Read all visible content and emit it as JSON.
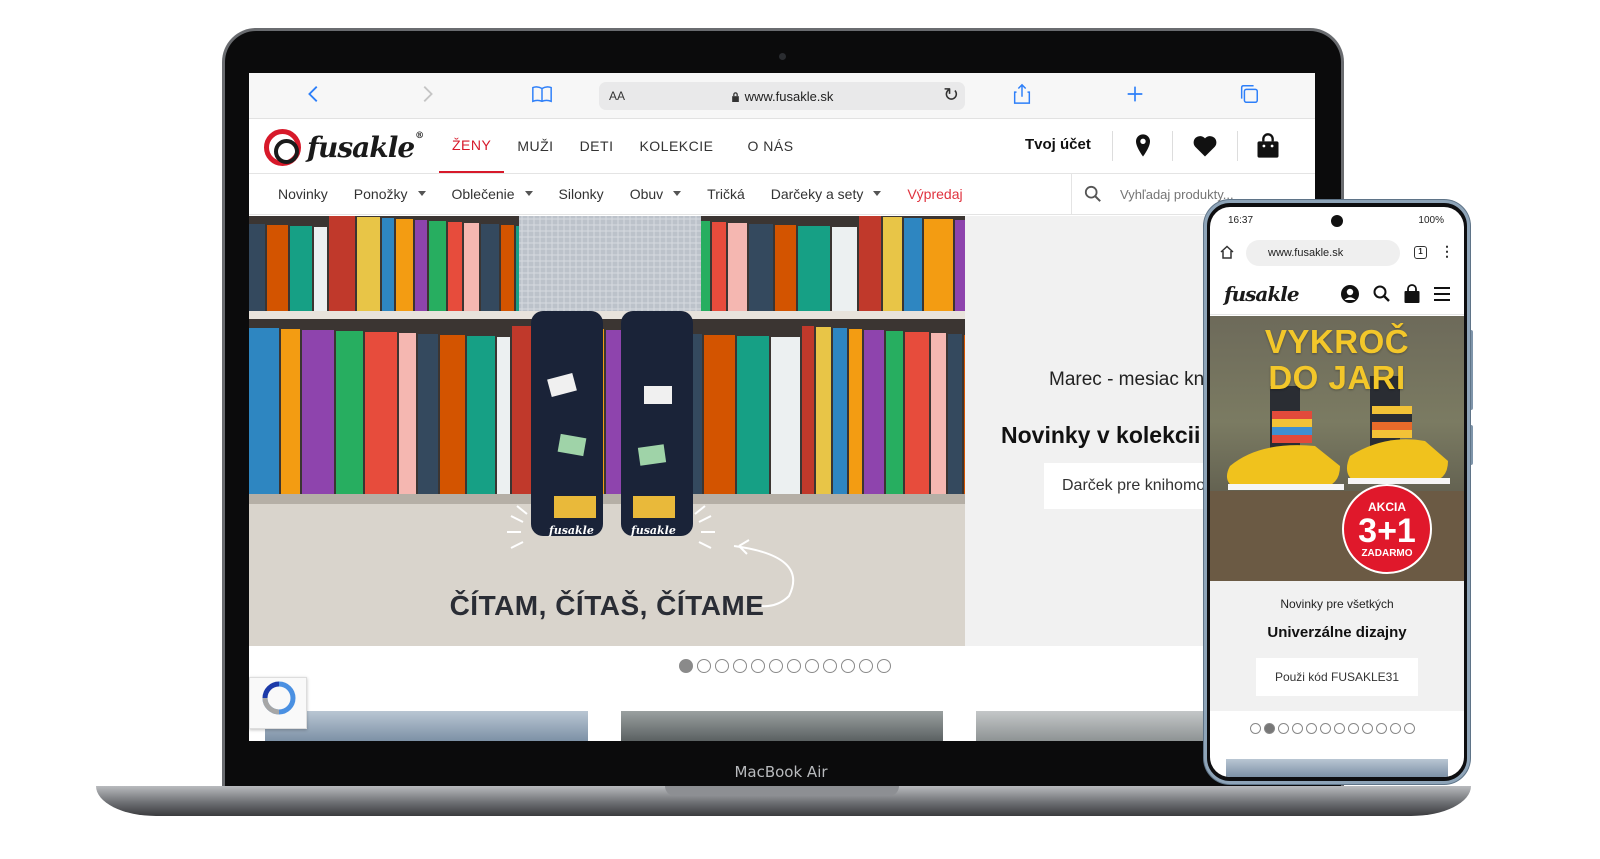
{
  "device": {
    "laptop_label": "MacBook Air"
  },
  "safari": {
    "aa_label": "AA",
    "url": "www.fusakle.sk"
  },
  "site": {
    "logo_text": "fusakle",
    "logo_reg": "®",
    "main_nav": [
      "ŽENY",
      "MUŽI",
      "DETI",
      "KOLEKCIE",
      "O NÁS"
    ],
    "account_label": "Tvoj účet",
    "categories": [
      {
        "label": "Novinky",
        "dropdown": false
      },
      {
        "label": "Ponožky",
        "dropdown": true
      },
      {
        "label": "Oblečenie",
        "dropdown": true
      },
      {
        "label": "Silonky",
        "dropdown": false
      },
      {
        "label": "Obuv",
        "dropdown": true
      },
      {
        "label": "Tričká",
        "dropdown": false
      },
      {
        "label": "Darčeky a sety",
        "dropdown": true
      },
      {
        "label": "Výpredaj",
        "dropdown": false
      }
    ],
    "search_placeholder": "Vyhľadaj produkty...",
    "hero": {
      "slogan": "ČÍTAM, ČÍTAŠ, ČÍTAME",
      "sock_brand": "fusakle",
      "subtitle": "Marec - mesiac kn",
      "title": "Novinky v kolekcii",
      "button": "Darček pre knihomo"
    },
    "slider_dots": 12,
    "slider_active": 0
  },
  "phone": {
    "time": "16:37",
    "battery": "100%",
    "url": "www.fusakle.sk",
    "tab_count": "1",
    "logo_text": "fusakle",
    "banner_title_line1": "VYKROČ",
    "banner_title_line2": "DO JARI",
    "badge_top": "AKCIA",
    "badge_mid": "3+1",
    "badge_bottom": "ZADARMO",
    "promo_sub": "Novinky pre všetkých",
    "promo_title": "Univerzálne dizajny",
    "promo_button": "Použi kód FUSAKLE31",
    "slider_dots": 12,
    "slider_active": 1
  },
  "colors": {
    "brand_red": "#d7192a",
    "safari_blue": "#2d7ff9",
    "sale_red": "#e0333f"
  }
}
